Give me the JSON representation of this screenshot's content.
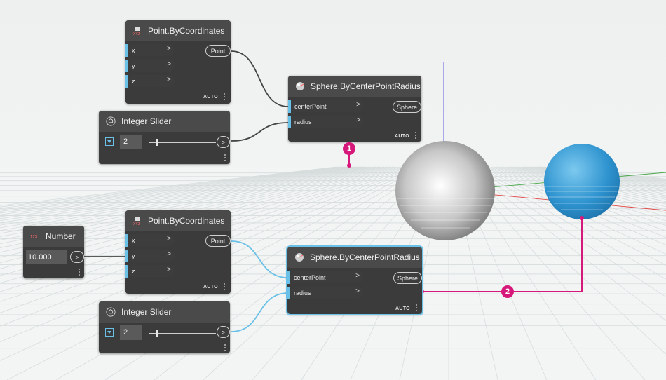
{
  "nodes": {
    "point_top": {
      "title": "Point.ByCoordinates",
      "inputs": [
        "x",
        "y",
        "z"
      ],
      "output": "Point",
      "lacing": "AUTO"
    },
    "slider_top": {
      "title": "Integer Slider",
      "value": "2"
    },
    "sphere_top": {
      "title": "Sphere.ByCenterPointRadius",
      "inputs": [
        "centerPoint",
        "radius"
      ],
      "output": "Sphere",
      "lacing": "AUTO"
    },
    "number": {
      "title": "Number",
      "value": "10.000"
    },
    "point_bottom": {
      "title": "Point.ByCoordinates",
      "inputs": [
        "x",
        "y",
        "z"
      ],
      "output": "Point",
      "lacing": "AUTO"
    },
    "sphere_bottom": {
      "title": "Sphere.ByCenterPointRadius",
      "inputs": [
        "centerPoint",
        "radius"
      ],
      "output": "Sphere",
      "lacing": "AUTO"
    },
    "slider_bottom": {
      "title": "Integer Slider",
      "value": "2"
    }
  },
  "icons": {
    "point_node": "point-coordinates-icon",
    "sphere_node": "sphere-icon",
    "slider_node": "integer-slider-icon",
    "number_node": "number-icon",
    "port_arrow": "chevron-right-icon"
  },
  "callouts": [
    "1",
    "2"
  ],
  "colors": {
    "wire_default": "#444444",
    "wire_selected": "#6ac0e7",
    "callout": "#d6187a",
    "sphere_preview": "#3399cc",
    "sphere_default": "#d9d9d9"
  }
}
